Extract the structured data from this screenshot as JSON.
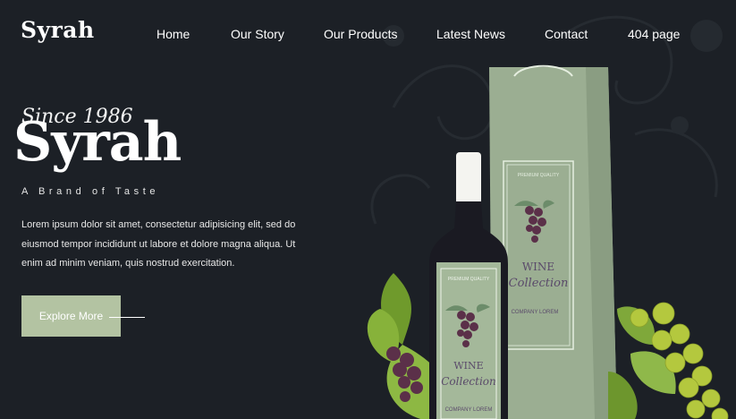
{
  "brand": {
    "logo": "Syrah"
  },
  "nav": {
    "items": [
      {
        "label": "Home"
      },
      {
        "label": "Our Story"
      },
      {
        "label": "Our Products"
      },
      {
        "label": "Latest News"
      },
      {
        "label": "Contact"
      },
      {
        "label": "404 page"
      }
    ]
  },
  "hero": {
    "since": "Since 1986",
    "title": "Syrah",
    "tagline": "A Brand of Taste",
    "description": "Lorem ipsum dolor sit amet, consectetur adipisicing elit, sed do eiusmod tempor incididunt ut labore et dolore magna aliqua. Ut enim ad minim veniam, quis nostrud exercitation.",
    "button_label": "Explore More"
  },
  "product": {
    "bag_top_label": "PREMIUM QUALITY",
    "bag_line1": "WINE",
    "bag_line2": "Collection",
    "bag_company": "COMPANY LOREM",
    "bottle_top_label": "PREMIUM QUALITY",
    "bottle_line1": "WINE",
    "bottle_line2": "Collection",
    "bottle_company": "COMPANY LOREM"
  },
  "colors": {
    "background": "#1c2026",
    "button": "#b3c3a2",
    "packaging": "#9bae92",
    "text": "#ffffff"
  }
}
